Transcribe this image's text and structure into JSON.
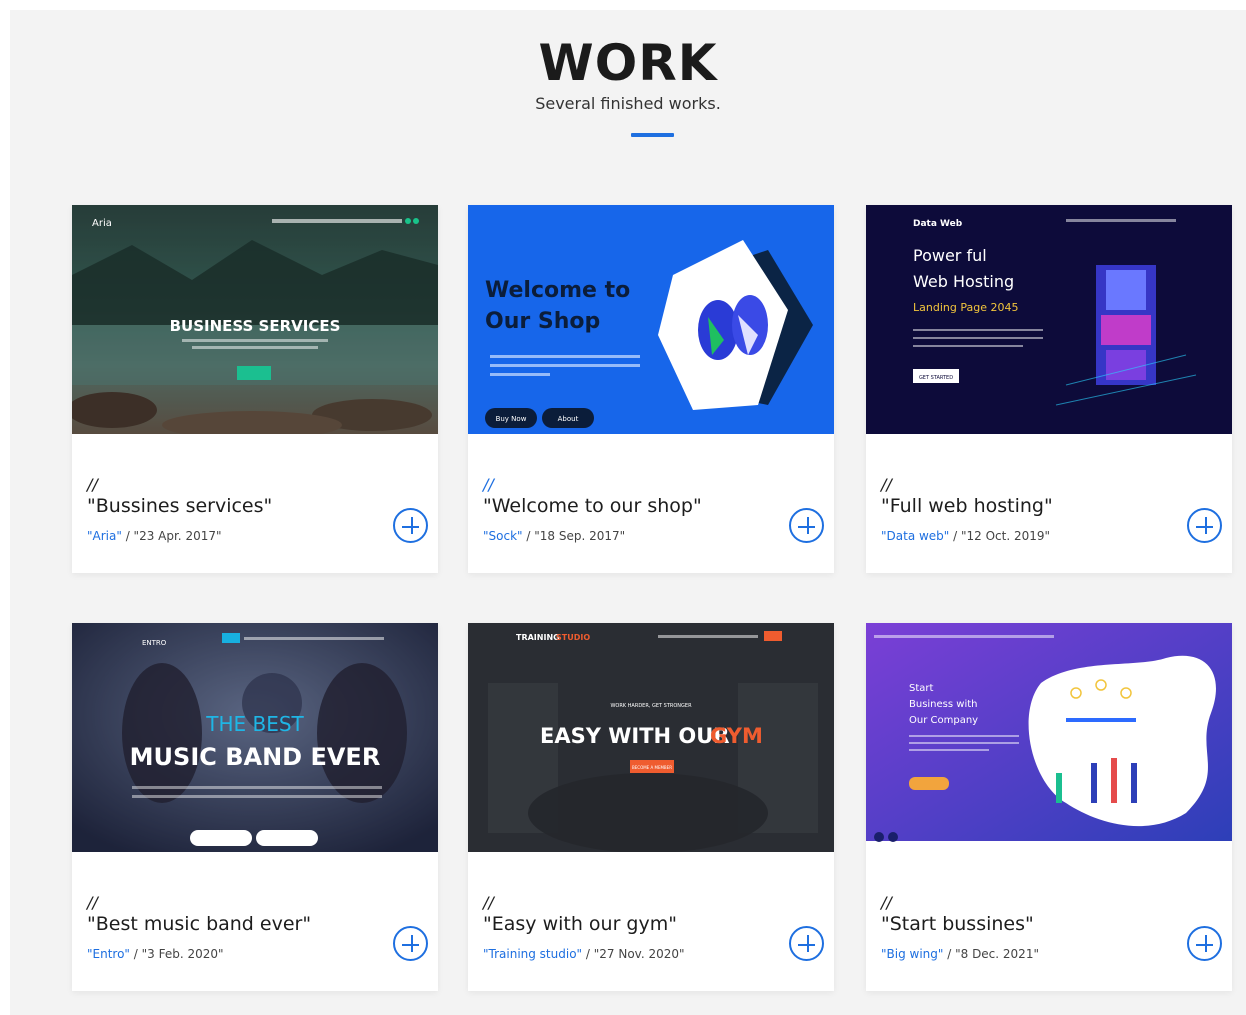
{
  "section": {
    "heading": "WORK",
    "subheading": "Several finished works."
  },
  "colors": {
    "accent": "#1e6fe0",
    "background": "#f3f3f3"
  },
  "cards": [
    {
      "slashes": "//",
      "title": "\"Bussines services\"",
      "client": "\"Aria\"",
      "separator": " / ",
      "date": "\"23 Apr. 2017\"",
      "thumb": {
        "brand": "Aria",
        "headline": "BUSINESS SERVICES"
      }
    },
    {
      "slashes": "//",
      "title": "\"Welcome to our shop\"",
      "client": "\"Sock\"",
      "separator": " / ",
      "date": "\"18 Sep. 2017\"",
      "thumb": {
        "headline1": "Welcome to",
        "headline2": "Our Shop",
        "button1": "Buy Now",
        "button2": "About"
      }
    },
    {
      "slashes": "//",
      "title": "\"Full web hosting\"",
      "client": "\"Data web\"",
      "separator": " / ",
      "date": "\"12 Oct. 2019\"",
      "thumb": {
        "brand": "Data Web",
        "headline1": "Power ful",
        "headline2": "Web Hosting",
        "headline3": "Landing Page 2045",
        "button": "GET STARTED"
      }
    },
    {
      "slashes": "//",
      "title": "\"Best music band ever\"",
      "client": "\"Entro\"",
      "separator": " / ",
      "date": "\"3 Feb. 2020\"",
      "thumb": {
        "brand": "ENTRO",
        "headline1": "THE BEST",
        "headline2": "MUSIC BAND EVER"
      }
    },
    {
      "slashes": "//",
      "title": "\"Easy with our gym\"",
      "client": "\"Training studio\"",
      "separator": " / ",
      "date": "\"27 Nov. 2020\"",
      "thumb": {
        "brand1": "TRAINING",
        "brand2": "STUDIO",
        "tagline": "WORK HARDER, GET STRONGER",
        "headline1": "EASY WITH OUR",
        "headline2": "GYM",
        "button": "BECOME A MEMBER"
      }
    },
    {
      "slashes": "//",
      "title": "\"Start bussines\"",
      "client": "\"Big wing\"",
      "separator": " / ",
      "date": "\"8 Dec. 2021\"",
      "thumb": {
        "headline1": "Start",
        "headline2": "Business with",
        "headline3": "Our Company"
      }
    }
  ]
}
